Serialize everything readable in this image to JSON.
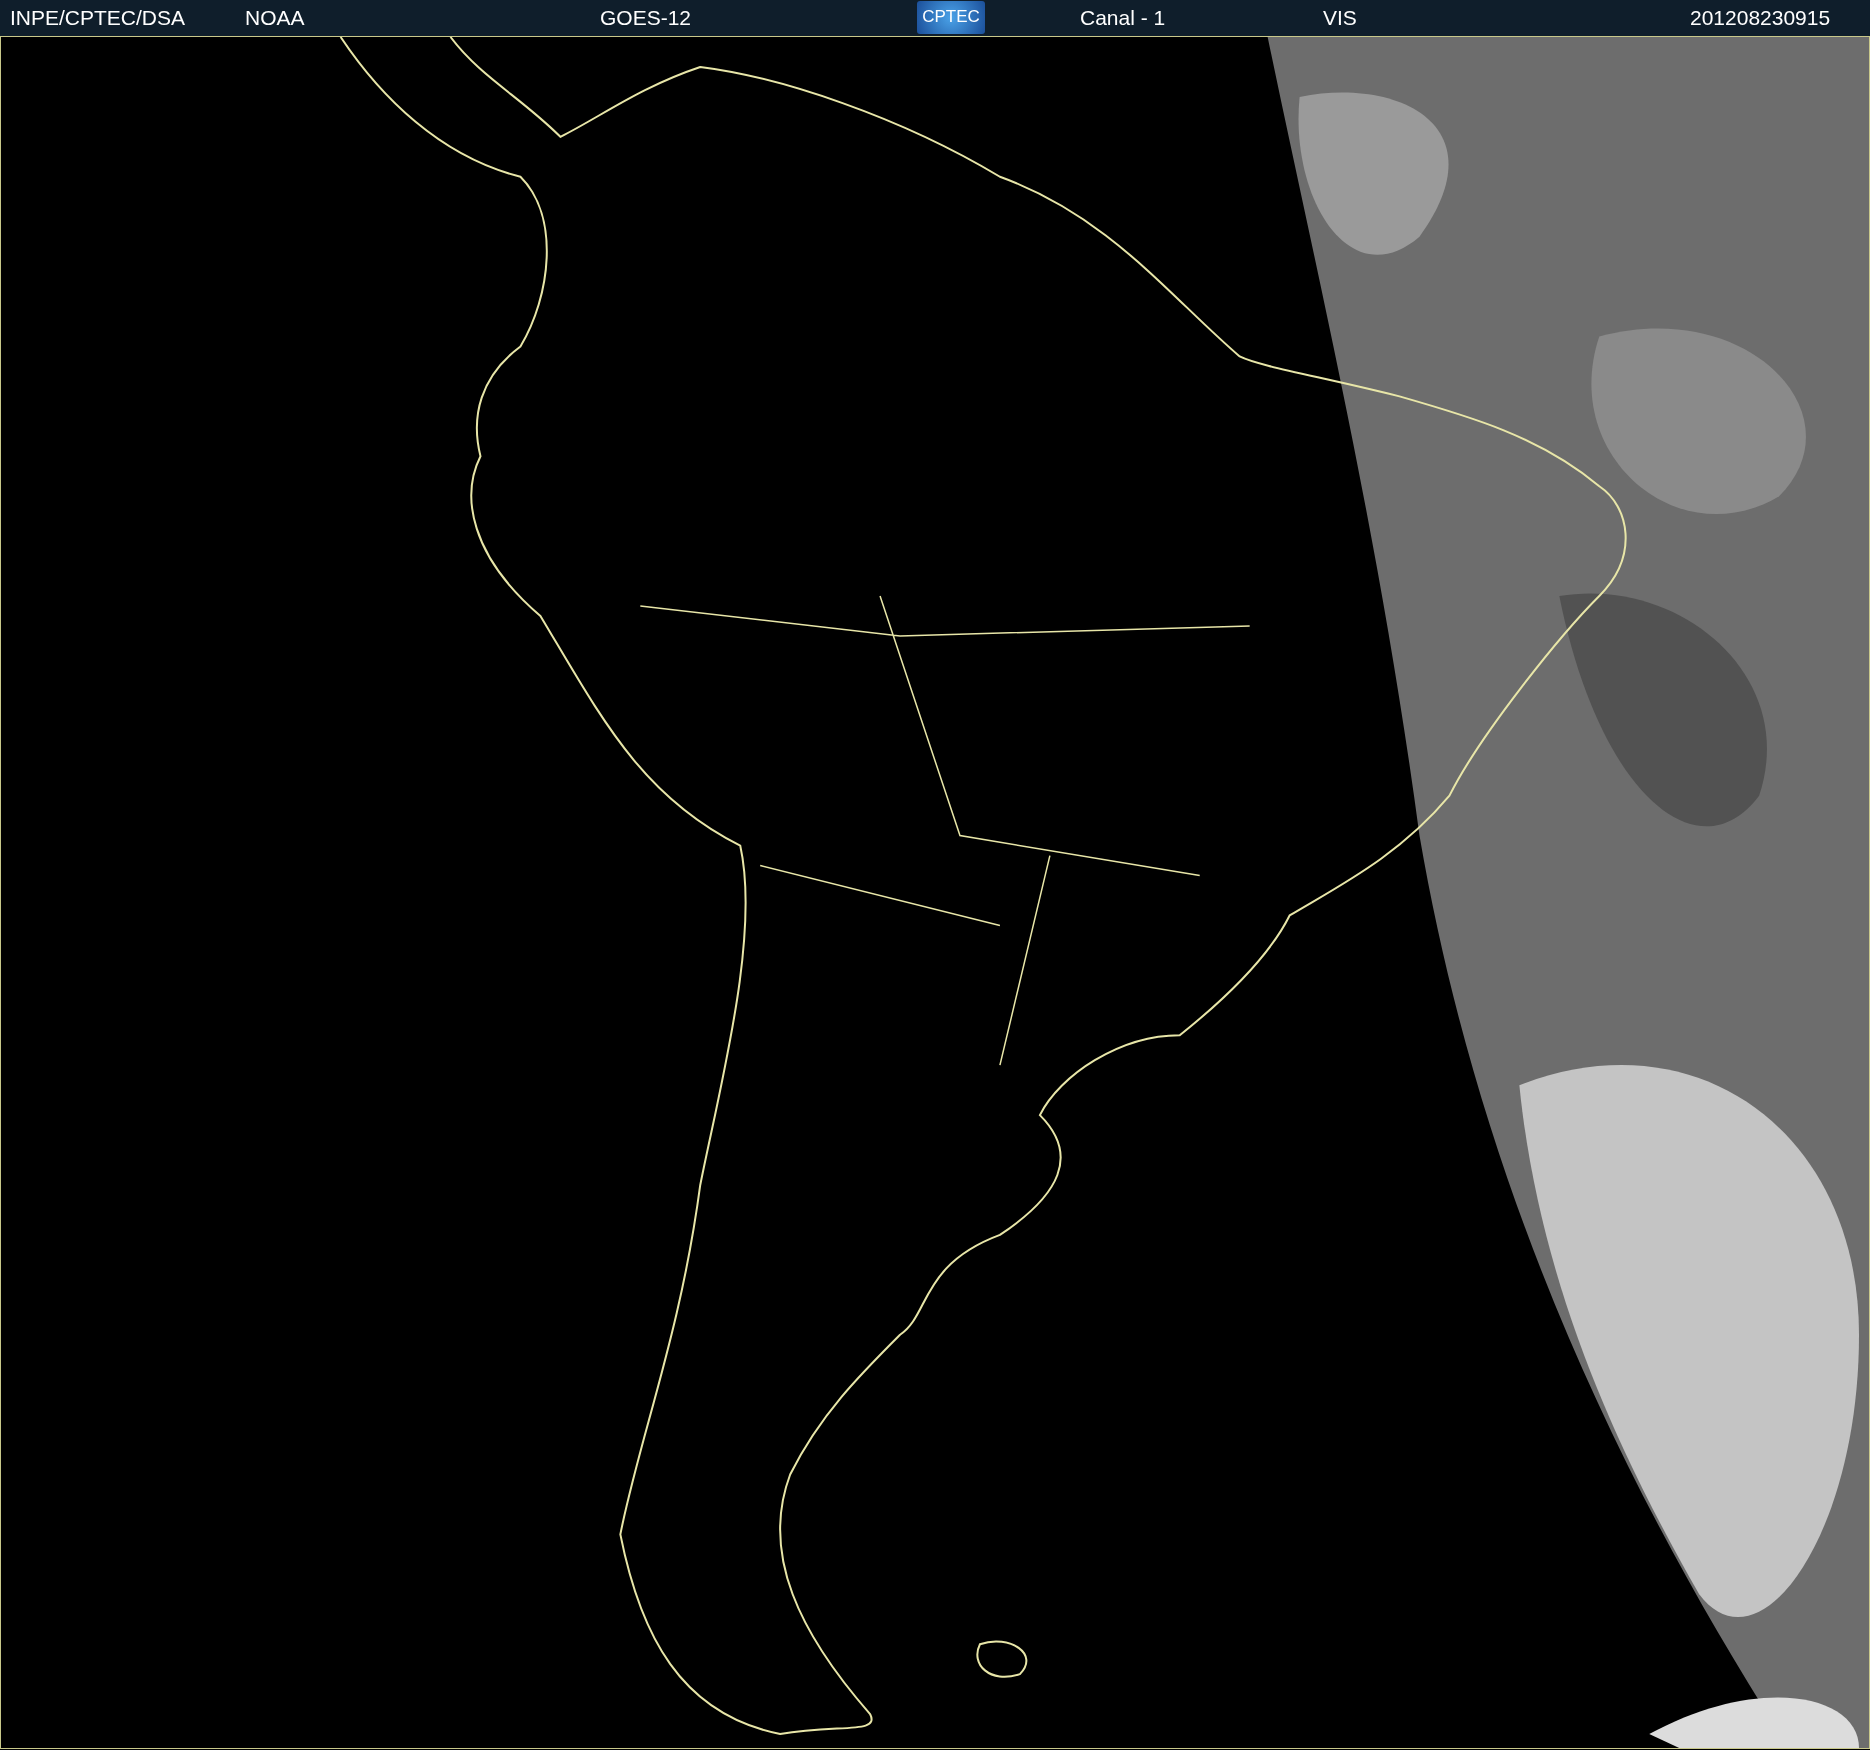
{
  "header": {
    "source": "INPE/CPTEC/DSA",
    "agency": "NOAA",
    "satellite": "GOES-12",
    "logo": "CPTEC",
    "channel": "Canal - 1",
    "band": "VIS",
    "timestamp": "201208230915"
  }
}
